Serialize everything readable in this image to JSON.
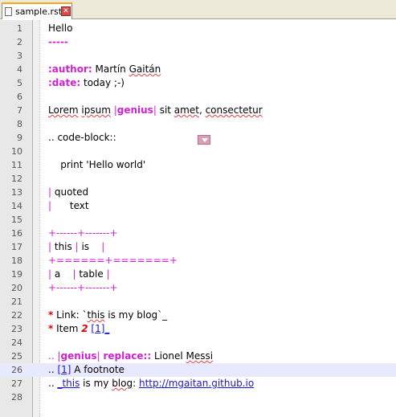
{
  "tab": {
    "filename": "sample.rst",
    "close_glyph": "✕"
  },
  "lines": [
    {
      "num": "1",
      "segments": [
        {
          "t": "Hello",
          "c": ""
        }
      ]
    },
    {
      "num": "2",
      "segments": [
        {
          "t": "-----",
          "c": "magb"
        }
      ]
    },
    {
      "num": "3",
      "segments": []
    },
    {
      "num": "4",
      "segments": [
        {
          "t": ":author:",
          "c": "magb"
        },
        {
          "t": " Martín ",
          "c": ""
        },
        {
          "t": "Gaitán",
          "c": "squig"
        }
      ]
    },
    {
      "num": "5",
      "segments": [
        {
          "t": ":date:",
          "c": "magb"
        },
        {
          "t": " today ;-)",
          "c": ""
        }
      ]
    },
    {
      "num": "6",
      "segments": []
    },
    {
      "num": "7",
      "segments": [
        {
          "t": "Lorem",
          "c": "squig"
        },
        {
          "t": " ",
          "c": ""
        },
        {
          "t": "ipsum",
          "c": "squig"
        },
        {
          "t": " |",
          "c": "mag"
        },
        {
          "t": "genius",
          "c": "magb"
        },
        {
          "t": "|",
          "c": "mag"
        },
        {
          "t": " sit ",
          "c": ""
        },
        {
          "t": "amet",
          "c": "squig"
        },
        {
          "t": ", ",
          "c": ""
        },
        {
          "t": "consectetur",
          "c": "squig"
        }
      ]
    },
    {
      "num": "8",
      "segments": []
    },
    {
      "num": "9",
      "segments": [
        {
          "t": ".. code-block::",
          "c": ""
        }
      ]
    },
    {
      "num": "10",
      "segments": []
    },
    {
      "num": "11",
      "segments": [
        {
          "t": "    print 'Hello world'",
          "c": ""
        }
      ]
    },
    {
      "num": "12",
      "segments": []
    },
    {
      "num": "13",
      "segments": [
        {
          "t": "|",
          "c": "mag"
        },
        {
          "t": " quoted",
          "c": ""
        }
      ]
    },
    {
      "num": "14",
      "segments": [
        {
          "t": "|",
          "c": "mag"
        },
        {
          "t": "      text",
          "c": ""
        }
      ]
    },
    {
      "num": "15",
      "segments": []
    },
    {
      "num": "16",
      "segments": [
        {
          "t": "+------+-------+",
          "c": "mag"
        }
      ]
    },
    {
      "num": "17",
      "segments": [
        {
          "t": "|",
          "c": "mag"
        },
        {
          "t": " this ",
          "c": ""
        },
        {
          "t": "|",
          "c": "mag"
        },
        {
          "t": " is    ",
          "c": ""
        },
        {
          "t": "|",
          "c": "mag"
        }
      ]
    },
    {
      "num": "18",
      "segments": [
        {
          "t": "+======+=======+",
          "c": "mag"
        }
      ]
    },
    {
      "num": "19",
      "segments": [
        {
          "t": "|",
          "c": "mag"
        },
        {
          "t": " a    ",
          "c": ""
        },
        {
          "t": "|",
          "c": "mag"
        },
        {
          "t": " table ",
          "c": ""
        },
        {
          "t": "|",
          "c": "mag"
        }
      ]
    },
    {
      "num": "20",
      "segments": [
        {
          "t": "+------+-------+",
          "c": "mag"
        }
      ]
    },
    {
      "num": "21",
      "segments": []
    },
    {
      "num": "22",
      "segments": [
        {
          "t": "*",
          "c": "red"
        },
        {
          "t": " Link: `",
          "c": ""
        },
        {
          "t": "this",
          "c": "squig"
        },
        {
          "t": " is my blog`_",
          "c": ""
        }
      ]
    },
    {
      "num": "23",
      "segments": [
        {
          "t": "*",
          "c": "red"
        },
        {
          "t": " Item ",
          "c": ""
        },
        {
          "t": "2",
          "c": "redi"
        },
        {
          "t": " ",
          "c": ""
        },
        {
          "t": "[1]_",
          "c": "lnk"
        }
      ]
    },
    {
      "num": "24",
      "segments": []
    },
    {
      "num": "25",
      "segments": [
        {
          "t": ".. |",
          "c": "mag"
        },
        {
          "t": "genius",
          "c": "magb"
        },
        {
          "t": "| ",
          "c": "mag"
        },
        {
          "t": "replace::",
          "c": "magb"
        },
        {
          "t": " Lionel ",
          "c": ""
        },
        {
          "t": "Messi",
          "c": "squig"
        }
      ]
    },
    {
      "num": "26",
      "segments": [
        {
          "t": ".. ",
          "c": ""
        },
        {
          "t": "[1]",
          "c": "lnk"
        },
        {
          "t": " A footnote",
          "c": ""
        }
      ]
    },
    {
      "num": "27",
      "segments": [
        {
          "t": ".. ",
          "c": ""
        },
        {
          "t": "_this",
          "c": "lnk"
        },
        {
          "t": " is my ",
          "c": ""
        },
        {
          "t": "blog",
          "c": "squig"
        },
        {
          "t": ": ",
          "c": ""
        },
        {
          "t": "http://mgaitan.github.io",
          "c": "lnk"
        }
      ]
    },
    {
      "num": "28",
      "segments": []
    }
  ],
  "current_line": "26"
}
